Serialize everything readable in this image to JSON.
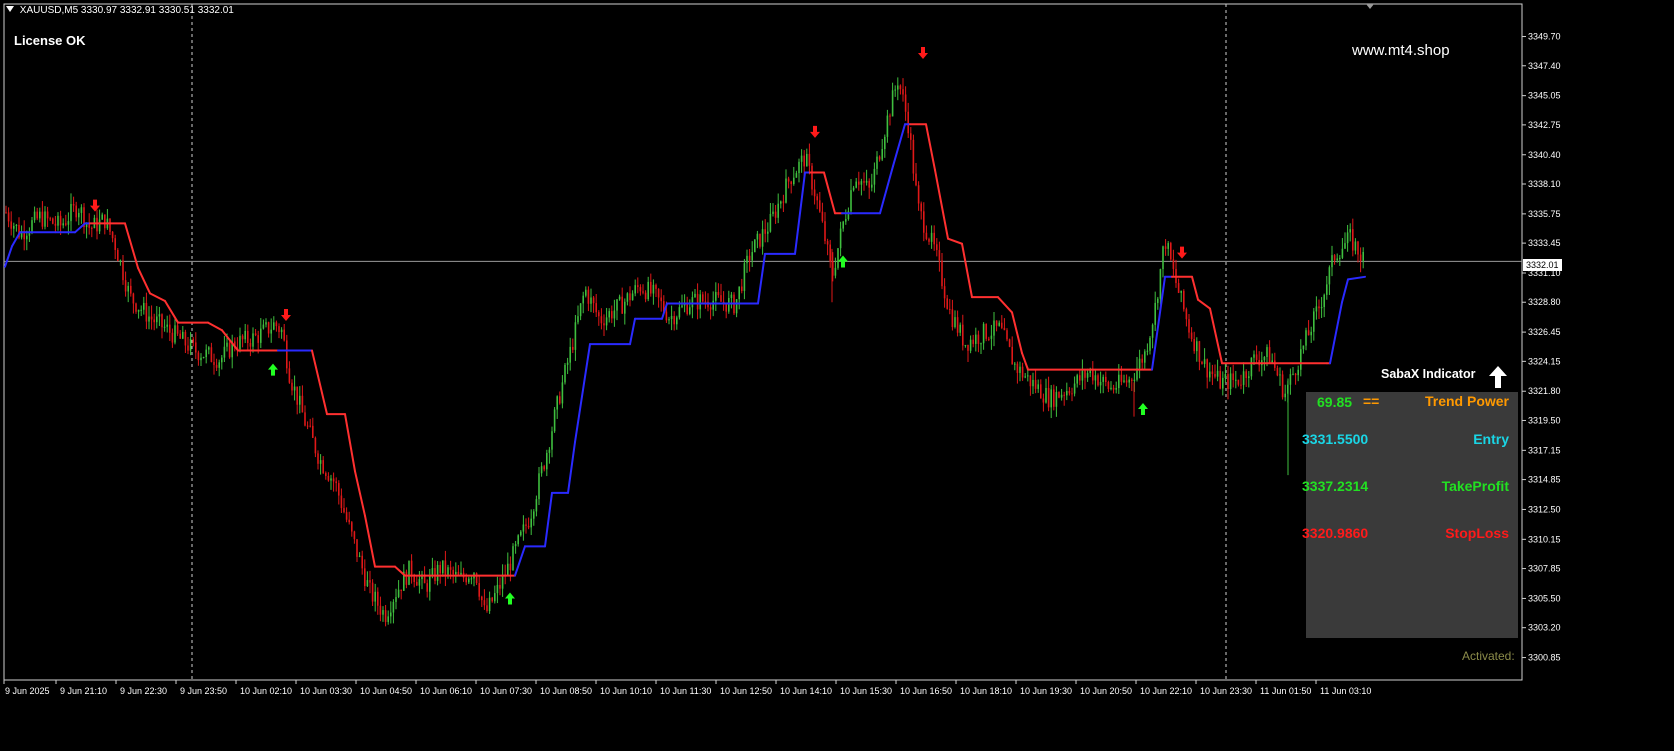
{
  "header": {
    "symbol": "XAUUSD,M5",
    "ohlc": "3330.97 3332.91 3330.51 3332.01"
  },
  "license_text": "License OK",
  "watermark": "www.mt4.shop",
  "indicator_panel": {
    "title": "SabaX Indicator",
    "trend_power_value": "69.85",
    "trend_power_sep": "==",
    "trend_power_label": "Trend Power",
    "entry_value": "3331.5500",
    "entry_label": "Entry",
    "takeprofit_value": "3337.2314",
    "takeprofit_label": "TakeProfit",
    "stoploss_value": "3320.9860",
    "stoploss_label": "StopLoss",
    "activated_text": "Activated:"
  },
  "colors": {
    "background": "#000000",
    "bull_candle": "#3fbf3f",
    "bear_candle": "#e01818",
    "trend_up": "#2a2aff",
    "trend_down": "#ff3030",
    "buy_arrow": "#22ff22",
    "sell_arrow": "#ff1a1a",
    "trend_power": "#ff9900",
    "entry": "#19d6e6",
    "takeprofit": "#22e022",
    "stoploss": "#ff1a1a"
  },
  "chart_data": {
    "type": "candlestick",
    "current_price": "3332.01",
    "ylim": [
      3299.4,
      3351.0
    ],
    "y_ticks": [
      "3349.70",
      "3347.40",
      "3345.05",
      "3342.75",
      "3340.40",
      "3338.10",
      "3335.75",
      "3333.45",
      "3331.10",
      "3328.80",
      "3326.45",
      "3324.15",
      "3321.80",
      "3319.50",
      "3317.15",
      "3314.85",
      "3312.50",
      "3310.15",
      "3307.85",
      "3305.50",
      "3303.20",
      "3300.85"
    ],
    "x_ticks": [
      "9 Jun 2025",
      "9 Jun 21:10",
      "9 Jun 22:30",
      "9 Jun 23:50",
      "10 Jun 02:10",
      "10 Jun 03:30",
      "10 Jun 04:50",
      "10 Jun 06:10",
      "10 Jun 07:30",
      "10 Jun 08:50",
      "10 Jun 10:10",
      "10 Jun 11:30",
      "10 Jun 12:50",
      "10 Jun 14:10",
      "10 Jun 15:30",
      "10 Jun 16:50",
      "10 Jun 18:10",
      "10 Jun 19:30",
      "10 Jun 20:50",
      "10 Jun 22:10",
      "10 Jun 23:30",
      "11 Jun 01:50",
      "11 Jun 03:10"
    ],
    "price_path": [
      [
        0,
        3331.6
      ],
      [
        5,
        3336.0
      ],
      [
        20,
        3334.2
      ],
      [
        40,
        3335.5
      ],
      [
        60,
        3334.8
      ],
      [
        78,
        3336.4
      ],
      [
        90,
        3334.6
      ],
      [
        105,
        3335.3
      ],
      [
        115,
        3333.4
      ],
      [
        130,
        3329.2
      ],
      [
        150,
        3327.6
      ],
      [
        175,
        3326.2
      ],
      [
        195,
        3325.0
      ],
      [
        220,
        3324.3
      ],
      [
        235,
        3325.6
      ],
      [
        255,
        3326.0
      ],
      [
        275,
        3327.1
      ],
      [
        282,
        3326.5
      ],
      [
        290,
        3323.0
      ],
      [
        305,
        3319.4
      ],
      [
        320,
        3316.4
      ],
      [
        335,
        3314.6
      ],
      [
        355,
        3309.6
      ],
      [
        370,
        3306.0
      ],
      [
        385,
        3304.2
      ],
      [
        395,
        3305.9
      ],
      [
        410,
        3307.8
      ],
      [
        425,
        3306.4
      ],
      [
        440,
        3307.9
      ],
      [
        460,
        3307.0
      ],
      [
        475,
        3307.8
      ],
      [
        485,
        3304.2
      ],
      [
        500,
        3306.5
      ],
      [
        515,
        3309.2
      ],
      [
        530,
        3312.0
      ],
      [
        545,
        3316.5
      ],
      [
        560,
        3321.6
      ],
      [
        575,
        3326.4
      ],
      [
        585,
        3329.8
      ],
      [
        600,
        3327.4
      ],
      [
        620,
        3328.5
      ],
      [
        640,
        3330.1
      ],
      [
        655,
        3329.3
      ],
      [
        670,
        3327.6
      ],
      [
        690,
        3328.8
      ],
      [
        710,
        3329.0
      ],
      [
        735,
        3328.6
      ],
      [
        750,
        3332.6
      ],
      [
        770,
        3335.0
      ],
      [
        790,
        3338.6
      ],
      [
        805,
        3340.2
      ],
      [
        815,
        3337.4
      ],
      [
        825,
        3333.8
      ],
      [
        832,
        3330.8
      ],
      [
        842,
        3334.6
      ],
      [
        855,
        3338.9
      ],
      [
        870,
        3337.5
      ],
      [
        885,
        3342.5
      ],
      [
        898,
        3346.4
      ],
      [
        908,
        3343.0
      ],
      [
        918,
        3336.2
      ],
      [
        935,
        3332.8
      ],
      [
        950,
        3328.0
      ],
      [
        965,
        3325.6
      ],
      [
        985,
        3326.4
      ],
      [
        1000,
        3326.7
      ],
      [
        1015,
        3323.8
      ],
      [
        1030,
        3322.6
      ],
      [
        1050,
        3321.2
      ],
      [
        1070,
        3322.1
      ],
      [
        1090,
        3323.4
      ],
      [
        1110,
        3322.0
      ],
      [
        1130,
        3322.7
      ],
      [
        1145,
        3324.8
      ],
      [
        1155,
        3328.3
      ],
      [
        1165,
        3333.8
      ],
      [
        1175,
        3330.6
      ],
      [
        1190,
        3326.5
      ],
      [
        1205,
        3323.8
      ],
      [
        1220,
        3322.5
      ],
      [
        1240,
        3322.7
      ],
      [
        1255,
        3324.4
      ],
      [
        1270,
        3324.6
      ],
      [
        1285,
        3321.6
      ],
      [
        1300,
        3324.6
      ],
      [
        1320,
        3328.6
      ],
      [
        1335,
        3332.6
      ],
      [
        1350,
        3333.8
      ],
      [
        1365,
        3332.01
      ]
    ],
    "trend_line": [
      [
        5,
        3331.6,
        "up"
      ],
      [
        12,
        3333.2,
        "up"
      ],
      [
        20,
        3334.3,
        "up"
      ],
      [
        75,
        3334.3,
        "up"
      ],
      [
        85,
        3335.0,
        "up"
      ],
      [
        90,
        3335.0,
        "down"
      ],
      [
        125,
        3335.0,
        "down"
      ],
      [
        138,
        3331.5,
        "down"
      ],
      [
        150,
        3329.5,
        "down"
      ],
      [
        165,
        3328.9,
        "down"
      ],
      [
        178,
        3327.2,
        "down"
      ],
      [
        208,
        3327.2,
        "down"
      ],
      [
        222,
        3326.6,
        "down"
      ],
      [
        238,
        3325.0,
        "down"
      ],
      [
        272,
        3325.0,
        "down"
      ],
      [
        278,
        3325.0,
        "up"
      ],
      [
        312,
        3325.0,
        "down"
      ],
      [
        327,
        3320.0,
        "down"
      ],
      [
        345,
        3320.0,
        "down"
      ],
      [
        355,
        3315.5,
        "down"
      ],
      [
        365,
        3312.0,
        "down"
      ],
      [
        375,
        3308.0,
        "down"
      ],
      [
        395,
        3308.0,
        "down"
      ],
      [
        405,
        3307.3,
        "down"
      ],
      [
        505,
        3307.3,
        "down"
      ],
      [
        515,
        3307.3,
        "up"
      ],
      [
        525,
        3309.6,
        "up"
      ],
      [
        545,
        3309.6,
        "up"
      ],
      [
        552,
        3313.8,
        "up"
      ],
      [
        568,
        3313.8,
        "up"
      ],
      [
        575,
        3317.8,
        "up"
      ],
      [
        590,
        3325.5,
        "up"
      ],
      [
        630,
        3325.5,
        "up"
      ],
      [
        635,
        3327.5,
        "up"
      ],
      [
        662,
        3327.5,
        "up"
      ],
      [
        667,
        3328.7,
        "up"
      ],
      [
        758,
        3328.7,
        "up"
      ],
      [
        765,
        3332.6,
        "up"
      ],
      [
        795,
        3332.6,
        "up"
      ],
      [
        805,
        3339.0,
        "up"
      ],
      [
        810,
        3339.0,
        "down"
      ],
      [
        824,
        3339.0,
        "down"
      ],
      [
        835,
        3335.8,
        "down"
      ],
      [
        842,
        3335.8,
        "up"
      ],
      [
        880,
        3335.8,
        "up"
      ],
      [
        893,
        3339.5,
        "up"
      ],
      [
        905,
        3342.8,
        "up"
      ],
      [
        910,
        3342.8,
        "down"
      ],
      [
        926,
        3342.8,
        "down"
      ],
      [
        935,
        3339.2,
        "down"
      ],
      [
        948,
        3333.8,
        "down"
      ],
      [
        962,
        3333.4,
        "down"
      ],
      [
        972,
        3329.2,
        "down"
      ],
      [
        998,
        3329.2,
        "down"
      ],
      [
        1012,
        3328.0,
        "down"
      ],
      [
        1022,
        3324.8,
        "down"
      ],
      [
        1028,
        3323.5,
        "down"
      ],
      [
        1143,
        3323.5,
        "down"
      ],
      [
        1152,
        3323.5,
        "up"
      ],
      [
        1165,
        3330.8,
        "up"
      ],
      [
        1172,
        3330.8,
        "down"
      ],
      [
        1192,
        3330.8,
        "down"
      ],
      [
        1198,
        3329.0,
        "down"
      ],
      [
        1210,
        3328.3,
        "down"
      ],
      [
        1222,
        3324.0,
        "down"
      ],
      [
        1327,
        3324.0,
        "down"
      ],
      [
        1330,
        3324.0,
        "up"
      ],
      [
        1342,
        3328.8,
        "up"
      ],
      [
        1348,
        3330.6,
        "up"
      ],
      [
        1365,
        3330.8,
        "up"
      ]
    ],
    "signals": [
      {
        "x": 95,
        "price": 3336.4,
        "dir": "down"
      },
      {
        "x": 286,
        "price": 3327.8,
        "dir": "down"
      },
      {
        "x": 273,
        "price": 3323.5,
        "dir": "up"
      },
      {
        "x": 510,
        "price": 3305.5,
        "dir": "up"
      },
      {
        "x": 815,
        "price": 3342.2,
        "dir": "down"
      },
      {
        "x": 843,
        "price": 3332.0,
        "dir": "up"
      },
      {
        "x": 923,
        "price": 3348.4,
        "dir": "down"
      },
      {
        "x": 1143,
        "price": 3320.4,
        "dir": "up"
      },
      {
        "x": 1182,
        "price": 3332.7,
        "dir": "down"
      },
      {
        "x": 1326,
        "price": 3320.3,
        "dir": "up"
      }
    ],
    "session_separators": [
      192,
      1226
    ]
  }
}
